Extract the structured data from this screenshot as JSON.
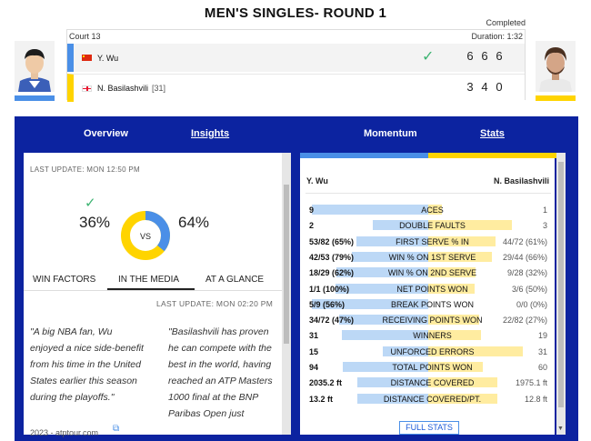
{
  "header": {
    "title": "MEN'S SINGLES- ROUND 1",
    "status": "Completed",
    "court": "Court 13",
    "duration": "Duration: 1:32"
  },
  "players": [
    {
      "name": "Y. Wu",
      "seed": "",
      "flag": "china-flag",
      "scores": [
        "6",
        "6",
        "6"
      ],
      "winner": true,
      "color": "#4a8fe7"
    },
    {
      "name": "N. Basilashvili",
      "seed": "[31]",
      "flag": "georgia-flag",
      "scores": [
        "3",
        "4",
        "0"
      ],
      "winner": false,
      "color": "#ffd400"
    }
  ],
  "nav": {
    "overview": "Overview",
    "insights": "Insights",
    "momentum": "Momentum",
    "stats": "Stats"
  },
  "insights": {
    "last_update": "LAST UPDATE: MON 12:50 PM",
    "win_pct_left": "36%",
    "win_pct_right": "64%",
    "win_pct_left_value": 36,
    "win_pct_right_value": 64,
    "vs": "VS",
    "tabs": [
      "WIN FACTORS",
      "IN THE MEDIA",
      "AT A GLANCE"
    ],
    "media_update": "LAST UPDATE: MON 02:20 PM",
    "quote_left": "\"A big NBA fan, Wu enjoyed a nice side-benefit from his time in the United States earlier this season during the playoffs.\"",
    "quote_left_source": "2023 - atptour.com",
    "quote_right": "\"Basilashvili has proven he can compete with the best in the world, having reached an ATP Masters 1000 final at the BNP Paribas Open just"
  },
  "stats": {
    "player_left": "Y. Wu",
    "player_right": "N. Basilashvili",
    "rows": [
      {
        "label": "ACES",
        "left": "9",
        "right": "1",
        "l": 9,
        "r": 1
      },
      {
        "label": "DOUBLE FAULTS",
        "left": "2",
        "right": "3",
        "l": 2,
        "r": 3
      },
      {
        "label": "FIRST SERVE % IN",
        "left": "53/82 (65%)",
        "right": "44/72 (61%)",
        "l": 65,
        "r": 61
      },
      {
        "label": "WIN % ON 1ST SERVE",
        "left": "42/53 (79%)",
        "right": "29/44 (66%)",
        "l": 79,
        "r": 66
      },
      {
        "label": "WIN % ON 2ND SERVE",
        "left": "18/29 (62%)",
        "right": "9/28 (32%)",
        "l": 62,
        "r": 32
      },
      {
        "label": "NET POINTS WON",
        "left": "1/1 (100%)",
        "right": "3/6 (50%)",
        "l": 100,
        "r": 50
      },
      {
        "label": "BREAK POINTS WON",
        "left": "5/9 (56%)",
        "right": "0/0 (0%)",
        "l": 56,
        "r": 0
      },
      {
        "label": "RECEIVING POINTS WON",
        "left": "34/72 (47%)",
        "right": "22/82 (27%)",
        "l": 47,
        "r": 27
      },
      {
        "label": "WINNERS",
        "left": "31",
        "right": "19",
        "l": 31,
        "r": 19
      },
      {
        "label": "UNFORCED ERRORS",
        "left": "15",
        "right": "31",
        "l": 15,
        "r": 31
      },
      {
        "label": "TOTAL POINTS WON",
        "left": "94",
        "right": "60",
        "l": 94,
        "r": 60
      },
      {
        "label": "DISTANCE COVERED",
        "left": "2035.2 ft",
        "right": "1975.1 ft",
        "l": 2035.2,
        "r": 1975.1
      },
      {
        "label": "DISTANCE COVERED/PT.",
        "left": "13.2 ft",
        "right": "12.8 ft",
        "l": 13.2,
        "r": 12.8
      }
    ],
    "full_stats": "FULL STATS"
  },
  "colors": {
    "panel": "#0c23a0",
    "player1": "#4a8fe7",
    "player2": "#ffd400",
    "win": "#3cb371"
  }
}
